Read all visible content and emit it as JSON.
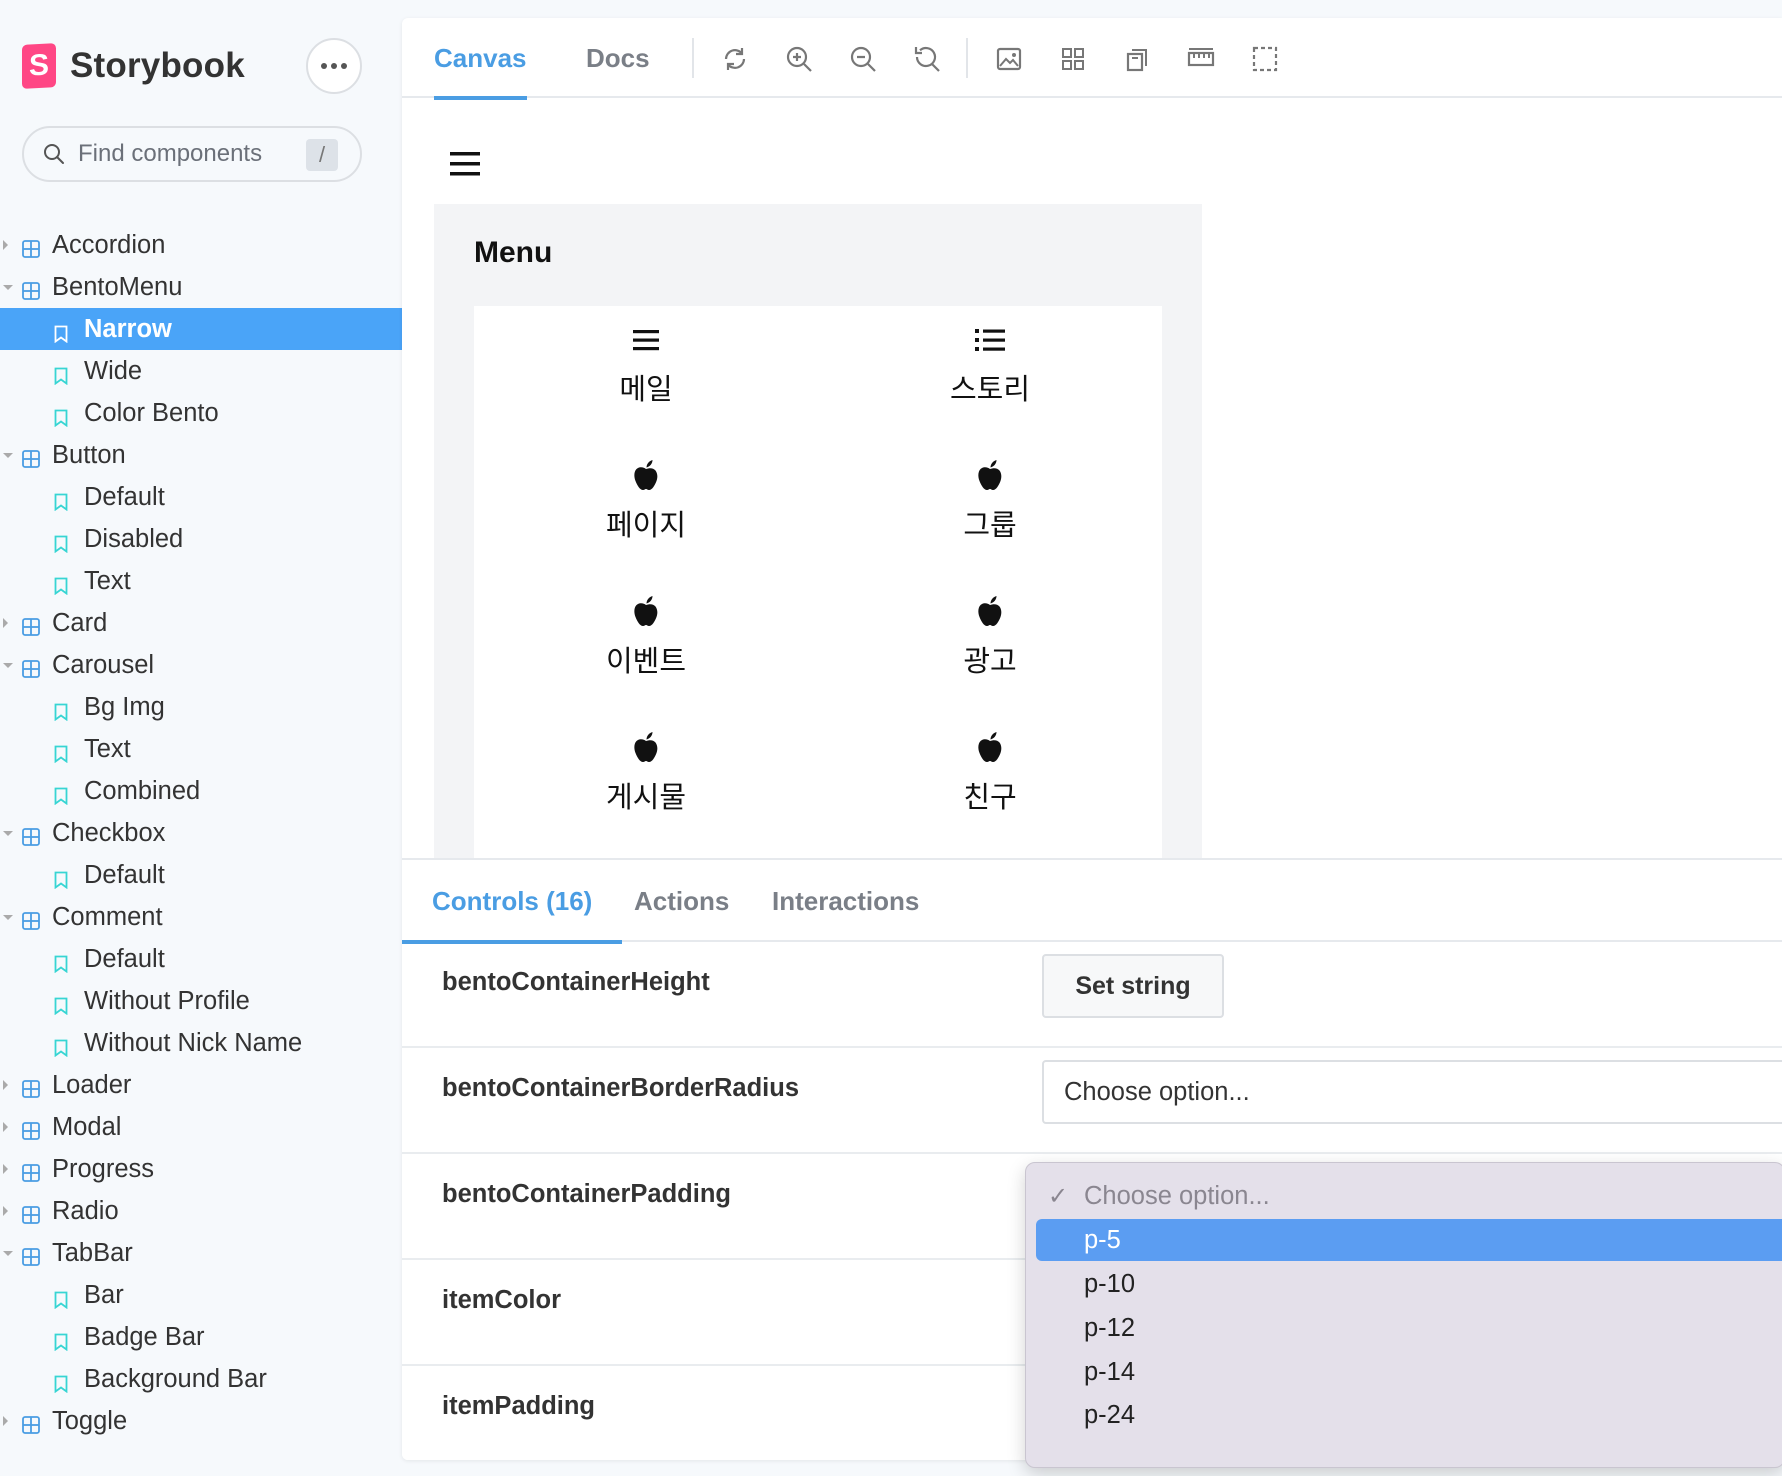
{
  "brand": {
    "name": "Storybook"
  },
  "search": {
    "placeholder": "Find components",
    "shortcut": "/"
  },
  "tree": [
    {
      "type": "group",
      "label": "Accordion",
      "expanded": false
    },
    {
      "type": "group",
      "label": "BentoMenu",
      "expanded": true
    },
    {
      "type": "story",
      "label": "Narrow",
      "selected": true
    },
    {
      "type": "story",
      "label": "Wide"
    },
    {
      "type": "story",
      "label": "Color Bento"
    },
    {
      "type": "group",
      "label": "Button",
      "expanded": true
    },
    {
      "type": "story",
      "label": "Default"
    },
    {
      "type": "story",
      "label": "Disabled"
    },
    {
      "type": "story",
      "label": "Text"
    },
    {
      "type": "group",
      "label": "Card",
      "expanded": false
    },
    {
      "type": "group",
      "label": "Carousel",
      "expanded": true
    },
    {
      "type": "story",
      "label": "Bg Img"
    },
    {
      "type": "story",
      "label": "Text"
    },
    {
      "type": "story",
      "label": "Combined"
    },
    {
      "type": "group",
      "label": "Checkbox",
      "expanded": true
    },
    {
      "type": "story",
      "label": "Default"
    },
    {
      "type": "group",
      "label": "Comment",
      "expanded": true
    },
    {
      "type": "story",
      "label": "Default"
    },
    {
      "type": "story",
      "label": "Without Profile"
    },
    {
      "type": "story",
      "label": "Without Nick Name"
    },
    {
      "type": "group",
      "label": "Loader",
      "expanded": false
    },
    {
      "type": "group",
      "label": "Modal",
      "expanded": false
    },
    {
      "type": "group",
      "label": "Progress",
      "expanded": false
    },
    {
      "type": "group",
      "label": "Radio",
      "expanded": false
    },
    {
      "type": "group",
      "label": "TabBar",
      "expanded": true
    },
    {
      "type": "story",
      "label": "Bar"
    },
    {
      "type": "story",
      "label": "Badge Bar"
    },
    {
      "type": "story",
      "label": "Background Bar"
    },
    {
      "type": "group",
      "label": "Toggle",
      "expanded": false
    }
  ],
  "toolbar": {
    "tabs": [
      {
        "label": "Canvas",
        "active": true
      },
      {
        "label": "Docs",
        "active": false
      }
    ],
    "icons": [
      "reload-icon",
      "zoom-in-icon",
      "zoom-out-icon",
      "zoom-reset-icon",
      "background-icon",
      "grid-icon",
      "viewport-icon",
      "measure-icon",
      "outline-icon"
    ]
  },
  "preview": {
    "title": "Menu",
    "items": [
      {
        "label": "메일",
        "icon": "hamburger-icon"
      },
      {
        "label": "스토리",
        "icon": "list-icon"
      },
      {
        "label": "페이지",
        "icon": "apple-icon"
      },
      {
        "label": "그룹",
        "icon": "apple-icon"
      },
      {
        "label": "이벤트",
        "icon": "apple-icon"
      },
      {
        "label": "광고",
        "icon": "apple-icon"
      },
      {
        "label": "게시물",
        "icon": "apple-icon"
      },
      {
        "label": "친구",
        "icon": "apple-icon"
      }
    ]
  },
  "addons": {
    "tabs": [
      {
        "label": "Controls (16)",
        "active": true
      },
      {
        "label": "Actions"
      },
      {
        "label": "Interactions"
      }
    ],
    "controls": [
      {
        "name": "bentoContainerHeight",
        "control": "button",
        "value": "Set string"
      },
      {
        "name": "bentoContainerBorderRadius",
        "control": "select",
        "value": "Choose option..."
      },
      {
        "name": "bentoContainerPadding",
        "control": "select-open"
      },
      {
        "name": "itemColor",
        "control": "none"
      },
      {
        "name": "itemPadding",
        "control": "none"
      }
    ]
  },
  "dropdown": {
    "options": [
      {
        "label": "Choose option...",
        "checked": true,
        "placeholder": true
      },
      {
        "label": "p-5",
        "highlighted": true
      },
      {
        "label": "p-10"
      },
      {
        "label": "p-12"
      },
      {
        "label": "p-14"
      },
      {
        "label": "p-24"
      }
    ]
  },
  "colors": {
    "accent": "#4a9de3",
    "selected": "#4aa4f8",
    "brand": "#ff4785",
    "dropdown_highlight": "#5b9df2"
  }
}
